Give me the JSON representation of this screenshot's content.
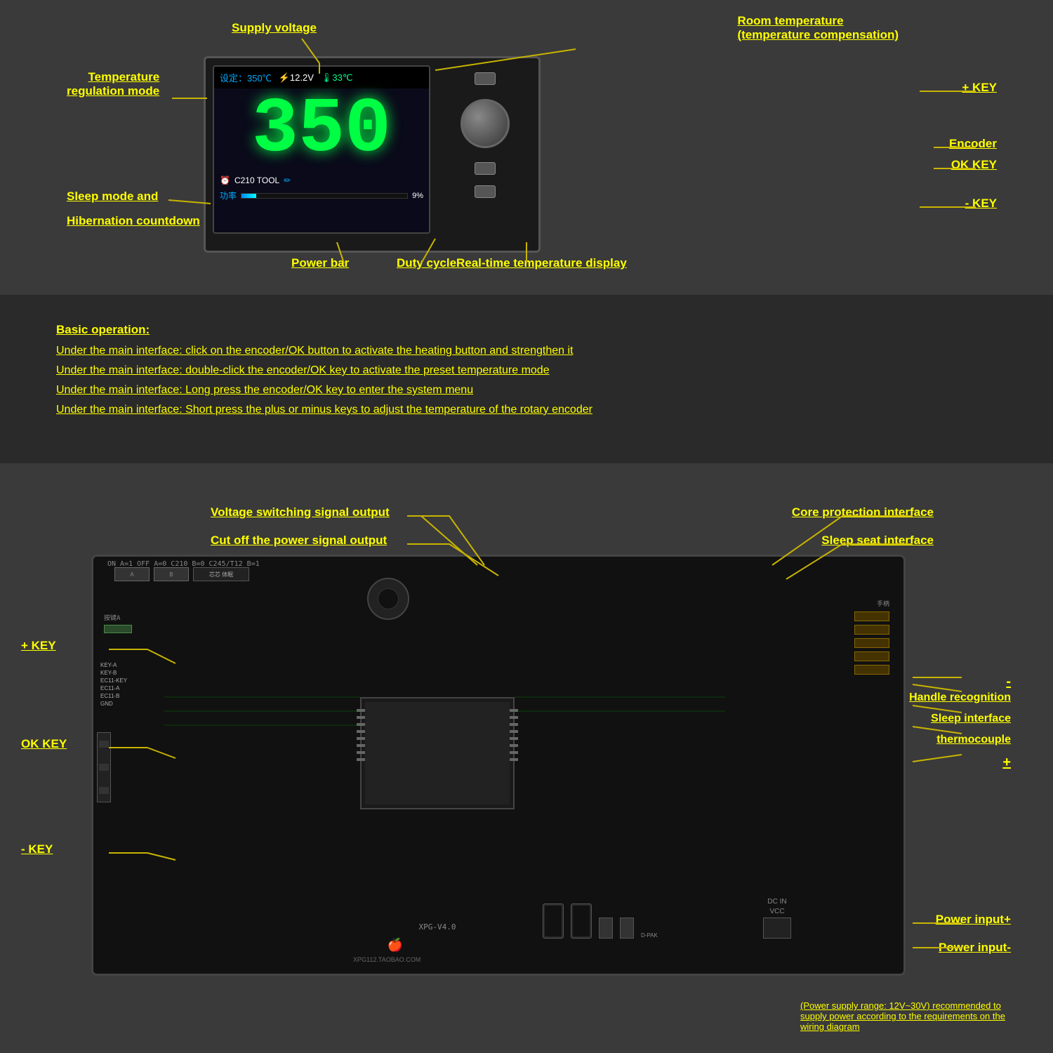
{
  "colors": {
    "background": "#3a3a3a",
    "label_color": "#ffff00",
    "line_color": "#c8b400",
    "lcd_green": "#00ff44",
    "lcd_blue": "#00aaff"
  },
  "top_labels": {
    "supply_voltage": "Supply voltage",
    "room_temperature": "Room temperature",
    "room_temp_sub": "(temperature compensation)",
    "plus_key": "+ KEY",
    "encoder": "Encoder",
    "ok_key": "OK KEY",
    "minus_key": "- KEY",
    "temp_regulation": "Temperature",
    "temp_regulation2": "regulation mode",
    "sleep_mode": "Sleep mode and",
    "hibernation": "Hibernation countdown",
    "power_bar": "Power bar",
    "duty_cycle": "Duty cycle",
    "realtime_temp": "Real-time temperature display"
  },
  "lcd": {
    "set_temp": "设定：350℃",
    "voltage": "⚡12.2V",
    "room_temp": "🌡33℃",
    "big_number": "350",
    "sleep_icon": "⏰",
    "tool_info": "C210  TOOL",
    "pencil_icon": "✏",
    "power_label": "功率",
    "power_percent": "9%"
  },
  "operations": {
    "title": "Basic operation:",
    "lines": [
      "Under the main interface: click on the encoder/OK button to activate the heating button and strengthen it",
      "Under the main interface: double-click the encoder/OK key to activate the preset temperature mode",
      "Under the main interface: Long press the encoder/OK key to enter the system menu",
      "Under the main interface: Short press the plus or minus keys to adjust the temperature of the rotary encoder"
    ]
  },
  "bottom_labels": {
    "voltage_switching": "Voltage switching signal output",
    "cut_off_power": "Cut off the power signal output",
    "core_protection": "Core protection interface",
    "sleep_seat": "Sleep seat interface",
    "plus_key": "+ KEY",
    "ok_key": "OK KEY",
    "minus_key": "- KEY",
    "minus_sign": "-",
    "handle_recognition": "Handle recognition",
    "sleep_interface": "Sleep interface",
    "thermocouple": "thermocouple",
    "plus_sign": "+",
    "power_input_plus": "Power input+",
    "power_input_minus": "Power input-",
    "power_note": "(Power supply range: 12V~30V) recommended to supply power according to the requirements on the wiring diagram"
  }
}
